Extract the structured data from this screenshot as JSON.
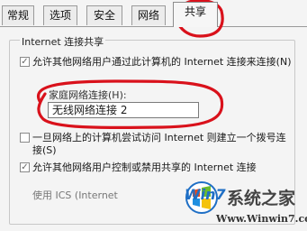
{
  "tabs": [
    "常规",
    "选项",
    "安全",
    "网络",
    "共享"
  ],
  "active_tab": "共享",
  "group": {
    "title": "Internet 连接共享"
  },
  "options": {
    "allow_share": {
      "text": "允许其他网络用户通过此计算机的 Internet 连接来连接(N)",
      "checked": true
    },
    "home_network_label": "家庭网络连接(H):",
    "home_network_value": "无线网络连接 2",
    "dialup": {
      "text": "一旦网络上的计算机尝试访问 Internet 则建立一个拨号连接(S)",
      "checked": false
    },
    "allow_control": {
      "text": "允许其他网络用户控制或禁用共享的 Internet 连接",
      "checked": true
    },
    "ics_text": "使用 ICS (Internet"
  },
  "watermark": {
    "name": "系统之家",
    "url": "Www.Winwin7.com",
    "logo_text": "Win7"
  },
  "colors": {
    "annotation": "#d9111b",
    "logo_blue": "#1f6fc5"
  }
}
